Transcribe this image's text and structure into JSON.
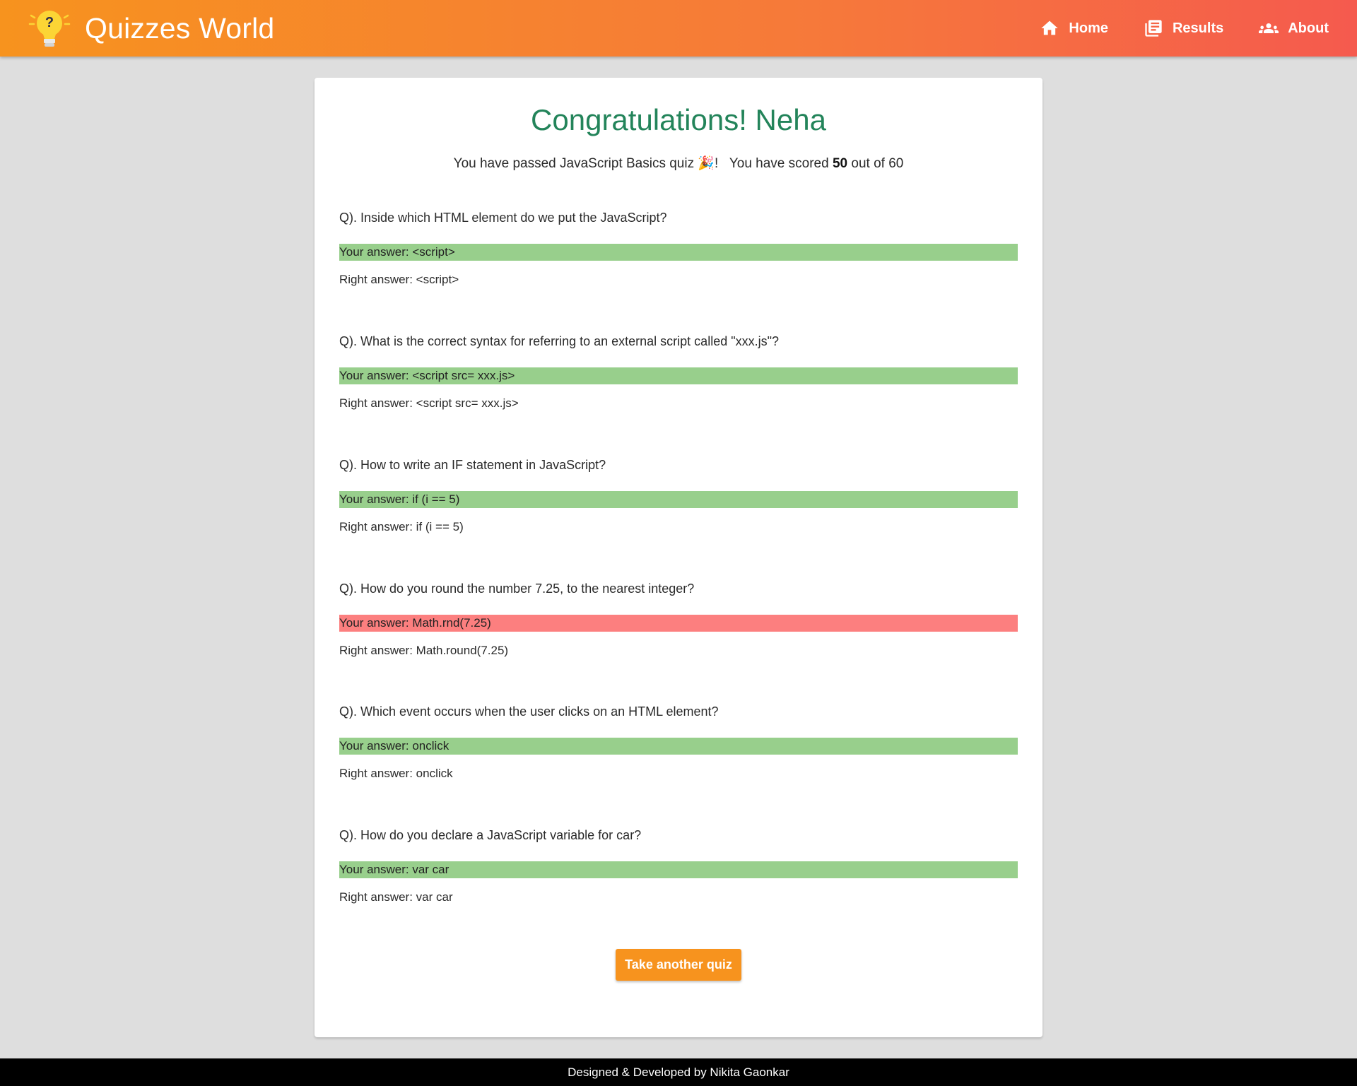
{
  "app": {
    "brand_title": "Quizzes World",
    "logo_icon": "lightbulb-question-icon"
  },
  "nav": {
    "home_label": "Home",
    "results_label": "Results",
    "about_label": "About"
  },
  "result": {
    "headline": "Congratulations! Neha",
    "passed_prefix": "You have passed JavaScript Basics quiz",
    "party_emoji": "🎉",
    "passed_suffix": "!",
    "score_prefix": "You have scored",
    "score": "50",
    "score_suffix": "out of 60"
  },
  "questions": [
    {
      "question": "Q). Inside which HTML element do we put the JavaScript?",
      "your_answer": "Your answer: <script>",
      "right_answer": "Right answer: <script>",
      "correct": true
    },
    {
      "question": "Q). What is the correct syntax for referring to an external script called \"xxx.js\"?",
      "your_answer": "Your answer: <script src= xxx.js>",
      "right_answer": "Right answer: <script src= xxx.js>",
      "correct": true
    },
    {
      "question": "Q). How to write an IF statement in JavaScript?",
      "your_answer": "Your answer: if (i == 5)",
      "right_answer": "Right answer: if (i == 5)",
      "correct": true
    },
    {
      "question": "Q). How do you round the number 7.25, to the nearest integer?",
      "your_answer": "Your answer: Math.rnd(7.25)",
      "right_answer": "Right answer: Math.round(7.25)",
      "correct": false
    },
    {
      "question": "Q). Which event occurs when the user clicks on an HTML element?",
      "your_answer": "Your answer: onclick",
      "right_answer": "Right answer: onclick",
      "correct": true
    },
    {
      "question": "Q). How do you declare a JavaScript variable for car?",
      "your_answer": "Your answer: var car",
      "right_answer": "Right answer: var car",
      "correct": true
    }
  ],
  "actions": {
    "take_another_label": "Take another quiz"
  },
  "footer": {
    "credit": "Designed & Developed by Nikita Gaonkar"
  },
  "colors": {
    "nav_gradient_start": "#f7931e",
    "nav_gradient_end": "#f55a4e",
    "headline": "#23845a",
    "correct_answer_bg": "#98cf8c",
    "wrong_answer_bg": "#fc7f7f",
    "button_bg": "#f7931e"
  }
}
